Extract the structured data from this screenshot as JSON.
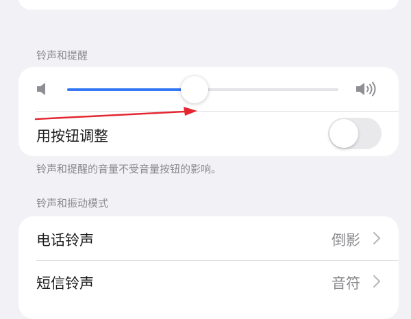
{
  "sections": {
    "ring_alerts_header": "铃声和提醒",
    "ring_alerts_footer": "铃声和提醒的音量不受音量按钮的影响。",
    "ringtone_vibration_header": "铃声和振动模式"
  },
  "volume": {
    "level": 0.47,
    "low_icon": "speaker-low-icon",
    "high_icon": "speaker-high-icon"
  },
  "change_with_buttons": {
    "label": "用按钮调整",
    "enabled": false
  },
  "sound_rows": [
    {
      "label": "电话铃声",
      "value": "倒影"
    },
    {
      "label": "短信铃声",
      "value": "音符"
    }
  ],
  "colors": {
    "accent": "#3478f6",
    "annotation_arrow": "#e3262f",
    "background": "#f2f2f6"
  }
}
